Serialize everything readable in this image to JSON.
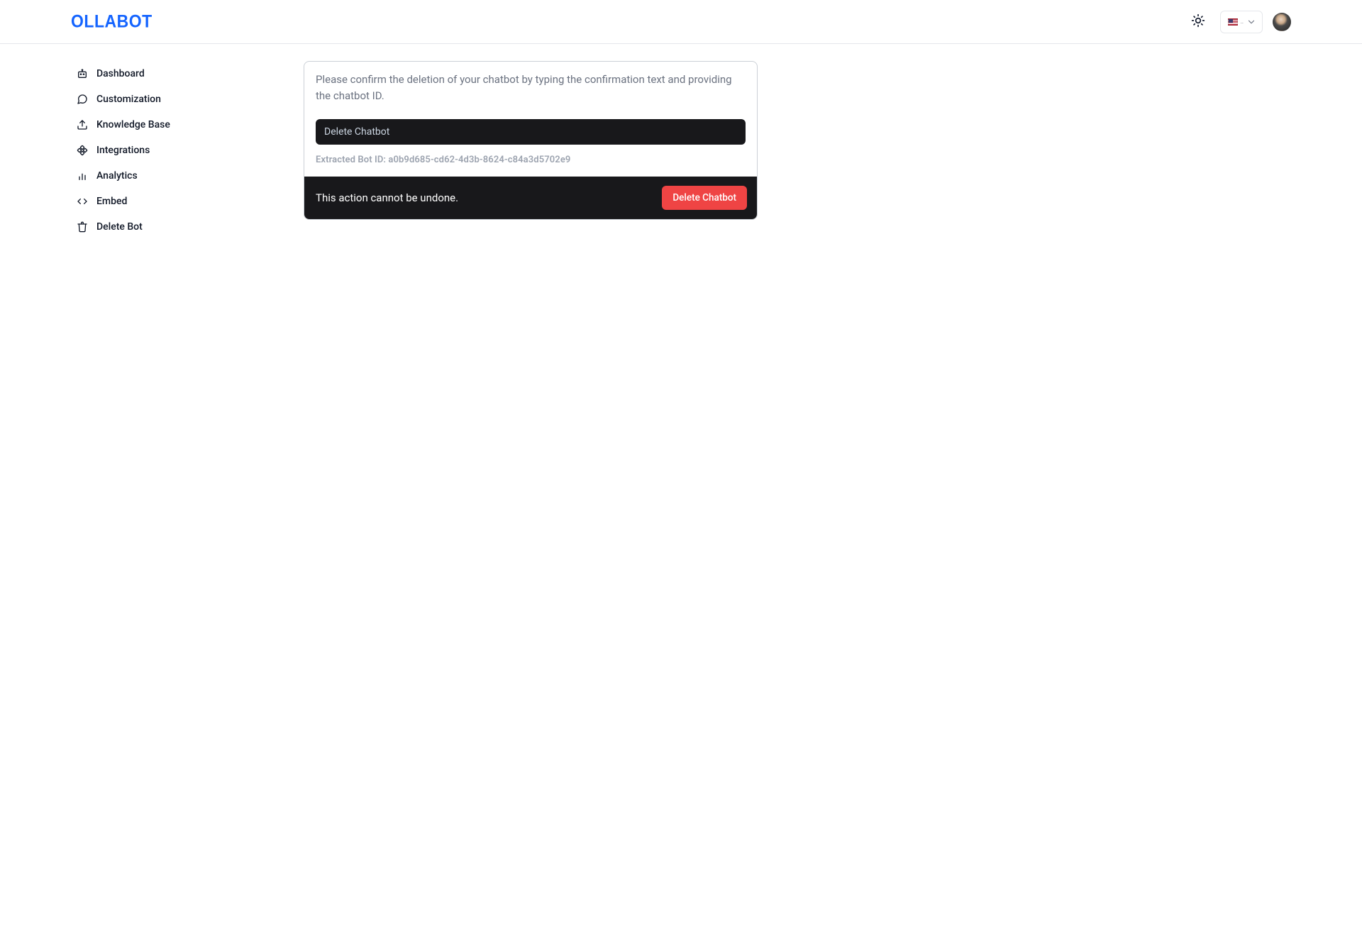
{
  "brand": "OLLABOT",
  "header": {
    "lang_code": "en"
  },
  "sidebar": {
    "items": [
      {
        "label": "Dashboard"
      },
      {
        "label": "Customization"
      },
      {
        "label": "Knowledge Base"
      },
      {
        "label": "Integrations"
      },
      {
        "label": "Analytics"
      },
      {
        "label": "Embed"
      },
      {
        "label": "Delete Bot"
      }
    ]
  },
  "main": {
    "instruction": "Please confirm the deletion of your chatbot by typing the confirmation text and providing the chatbot ID.",
    "input_value": "Delete Chatbot",
    "extracted_label": "Extracted Bot ID: a0b9d685-cd62-4d3b-8624-c84a3d5702e9",
    "footer_warning": "This action cannot be undone.",
    "delete_button": "Delete Chatbot"
  }
}
